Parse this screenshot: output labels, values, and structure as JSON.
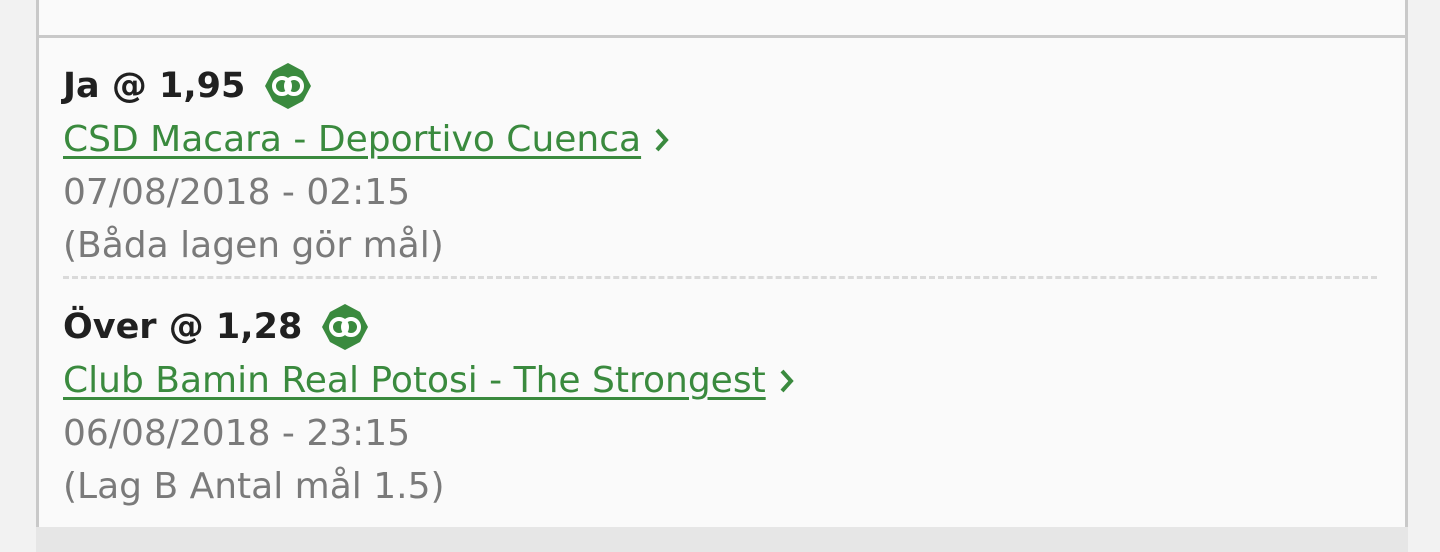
{
  "bets": [
    {
      "pick": "Ja @ 1,95",
      "icon": "eye-badge-icon",
      "match": "CSD Macara - Deportivo Cuenca",
      "datetime": "07/08/2018 - 02:15",
      "market": "(Båda lagen gör mål)"
    },
    {
      "pick": "Över @ 1,28",
      "icon": "eye-badge-icon",
      "match": "Club Bamin Real Potosi - The Strongest",
      "datetime": "06/08/2018 - 23:15",
      "market": "(Lag B Antal mål 1.5)"
    }
  ],
  "colors": {
    "accent": "#3a8a3e",
    "pick_text": "#202020",
    "meta_text": "#7a7a7a",
    "border": "#c9c9c9"
  }
}
